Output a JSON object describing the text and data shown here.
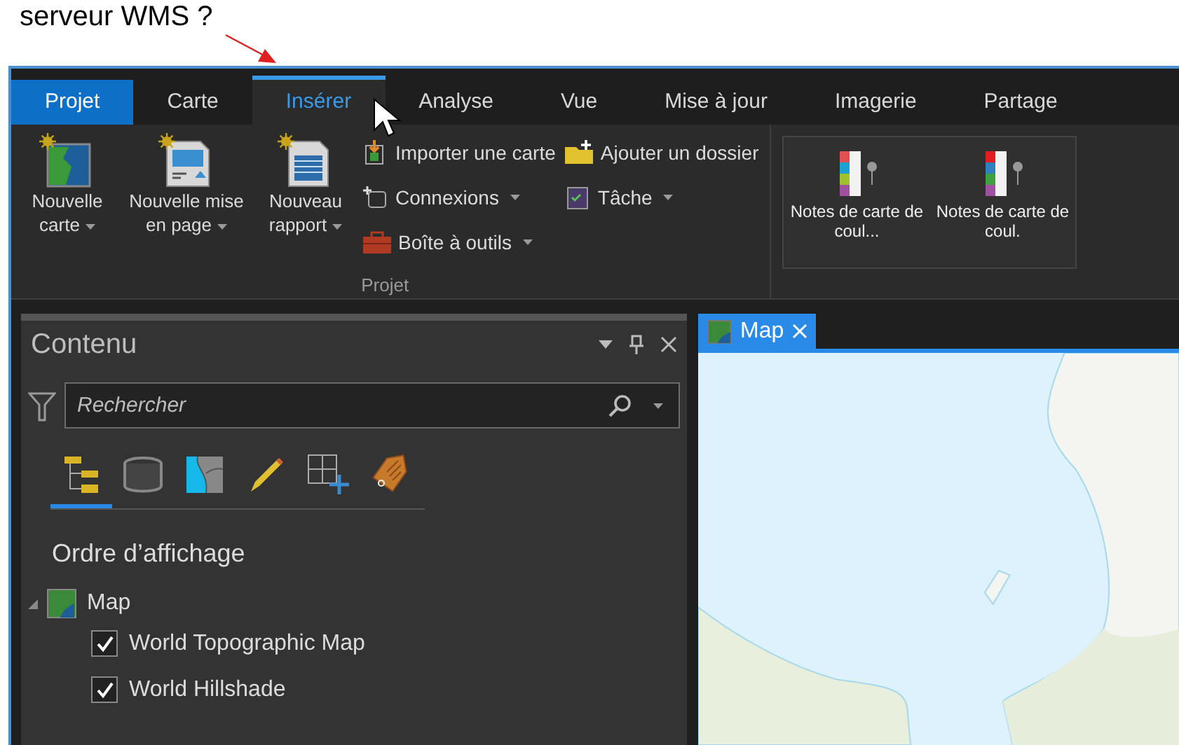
{
  "annotation": {
    "text": "serveur WMS ?"
  },
  "tabs": [
    {
      "label": "Projet",
      "kind": "file",
      "selected": false
    },
    {
      "label": "Carte",
      "kind": "tab",
      "selected": false
    },
    {
      "label": "Insérer",
      "kind": "tab",
      "selected": true
    },
    {
      "label": "Analyse",
      "kind": "tab",
      "selected": false
    },
    {
      "label": "Vue",
      "kind": "tab",
      "selected": false
    },
    {
      "label": "Mise à jour",
      "kind": "tab",
      "selected": false
    },
    {
      "label": "Imagerie",
      "kind": "tab",
      "selected": false
    },
    {
      "label": "Partage",
      "kind": "tab",
      "selected": false
    }
  ],
  "ribbon": {
    "groups": [
      {
        "label": "Projet",
        "large_buttons": [
          {
            "label": "Nouvelle carte",
            "kind": "map",
            "dropdown": true
          },
          {
            "label": "Nouvelle mise en page",
            "kind": "layout",
            "dropdown": true
          },
          {
            "label": "Nouveau rapport",
            "kind": "report",
            "dropdown": true
          }
        ],
        "small_columns": [
          [
            {
              "label": "Importer une carte",
              "kind": "import",
              "dropdown": false
            },
            {
              "label": "Connexions",
              "kind": "connect",
              "dropdown": true
            },
            {
              "label": "Boîte à outils",
              "kind": "toolbox",
              "dropdown": true
            }
          ],
          [
            {
              "label": "Ajouter un dossier",
              "kind": "folder",
              "dropdown": false
            },
            {
              "label": "Tâche",
              "kind": "task",
              "dropdown": true
            }
          ]
        ]
      },
      {
        "notes": [
          {
            "label": "Notes de carte de coul..."
          },
          {
            "label": "Notes de carte de coul."
          }
        ]
      }
    ]
  },
  "contents_pane": {
    "title": "Contenu",
    "search": {
      "placeholder": "Rechercher"
    },
    "view_tabs": [
      {
        "kind": "drawing_order",
        "selected": true
      },
      {
        "kind": "source",
        "selected": false
      },
      {
        "kind": "selection",
        "selected": false
      },
      {
        "kind": "editing",
        "selected": false
      },
      {
        "kind": "snapping",
        "selected": false
      },
      {
        "kind": "labeling",
        "selected": false
      }
    ],
    "heading": "Ordre d’affichage",
    "tree": [
      {
        "label": "Map",
        "expanded": true,
        "children": [
          {
            "label": "World Topographic Map",
            "checked": true
          },
          {
            "label": "World Hillshade",
            "checked": true
          }
        ]
      }
    ]
  },
  "map_view": {
    "tabs": [
      {
        "label": "Map",
        "selected": true
      }
    ]
  }
}
